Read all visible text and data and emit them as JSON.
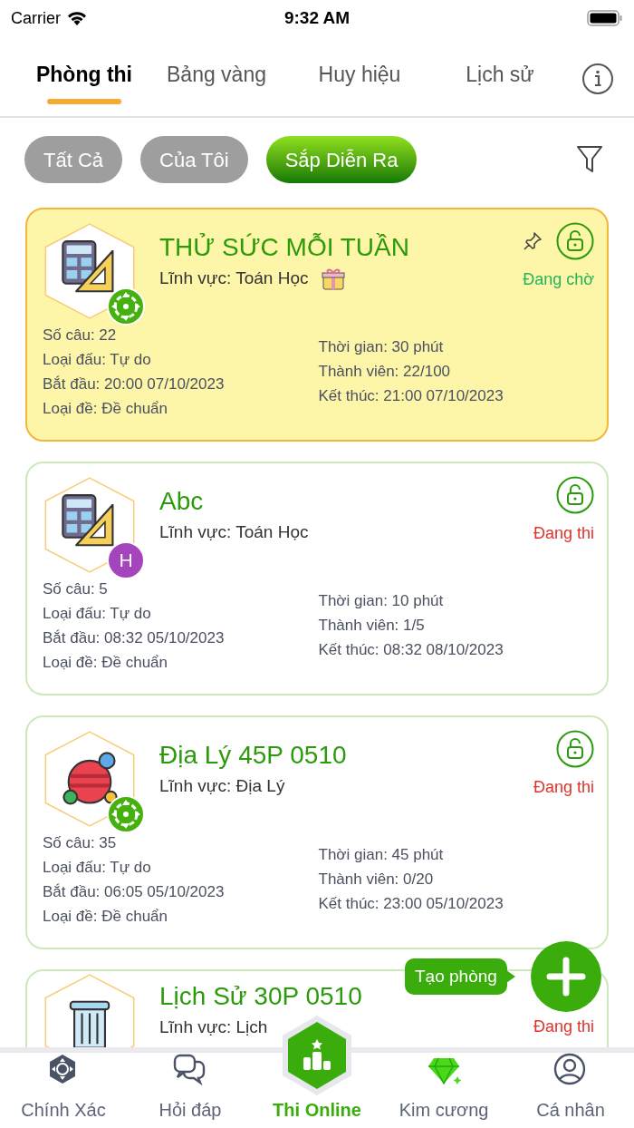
{
  "status_bar": {
    "carrier": "Carrier",
    "time": "9:32 AM"
  },
  "tabs": [
    {
      "label": "Phòng thi",
      "selected": true
    },
    {
      "label": "Bảng vàng",
      "selected": false
    },
    {
      "label": "Huy hiệu",
      "selected": false
    },
    {
      "label": "Lịch sử",
      "selected": false
    }
  ],
  "filters": [
    {
      "label": "Tất Cả",
      "selected": false
    },
    {
      "label": "Của Tôi",
      "selected": false
    },
    {
      "label": "Sắp Diễn Ra",
      "selected": true
    }
  ],
  "rooms": [
    {
      "kind": "math",
      "title": "THỬ SỨC MỖI TUẦN",
      "field": "Lĩnh vực: Toán Học",
      "highlighted": true,
      "gift": true,
      "pinned": true,
      "badge": {
        "kind": "target"
      },
      "status": {
        "text": "Đang chờ",
        "kind": "waiting"
      },
      "details_left": [
        "Số câu: 22",
        "Loại đấu: Tự do",
        "Bắt đầu: 20:00 07/10/2023",
        "Loại đề: Đề chuẩn"
      ],
      "details_right": [
        "Thời gian: 30 phút",
        "Thành viên: 22/100",
        "Kết thúc: 21:00 07/10/2023"
      ]
    },
    {
      "kind": "math",
      "title": "Abc",
      "field": "Lĩnh vực: Toán Học",
      "highlighted": false,
      "gift": false,
      "pinned": false,
      "badge": {
        "kind": "letter",
        "text": "H",
        "color": "#a545bd"
      },
      "status": {
        "text": "Đang thi",
        "kind": "ongoing"
      },
      "details_left": [
        "Số câu: 5",
        "Loại đấu: Tự do",
        "Bắt đầu: 08:32 05/10/2023",
        "Loại đề: Đề chuẩn"
      ],
      "details_right": [
        "Thời gian: 10 phút",
        "Thành viên: 1/5",
        "Kết thúc: 08:32 08/10/2023"
      ]
    },
    {
      "kind": "geography",
      "title": "Địa Lý 45P 0510",
      "field": "Lĩnh vực: Địa Lý",
      "highlighted": false,
      "gift": false,
      "pinned": false,
      "badge": {
        "kind": "target"
      },
      "status": {
        "text": "Đang thi",
        "kind": "ongoing"
      },
      "details_left": [
        "Số câu: 35",
        "Loại đấu: Tự do",
        "Bắt đầu: 06:05 05/10/2023",
        "Loại đề: Đề chuẩn"
      ],
      "details_right": [
        "Thời gian: 45 phút",
        "Thành viên: 0/20",
        "Kết thúc: 23:00 05/10/2023"
      ]
    },
    {
      "kind": "history",
      "title": "Lịch Sử 30P 0510",
      "field": "Lĩnh vực: Lịch",
      "highlighted": false,
      "gift": false,
      "pinned": false,
      "status": {
        "text": "Đang thi",
        "kind": "ongoing"
      }
    }
  ],
  "create_room": {
    "tooltip": "Tạo phòng"
  },
  "bottom_nav": [
    {
      "label": "Chính Xác",
      "selected": false
    },
    {
      "label": "Hỏi đáp",
      "selected": false
    },
    {
      "label": "Thi Online",
      "selected": true
    },
    {
      "label": "Kim cương",
      "selected": false
    },
    {
      "label": "Cá nhân",
      "selected": false
    }
  ]
}
